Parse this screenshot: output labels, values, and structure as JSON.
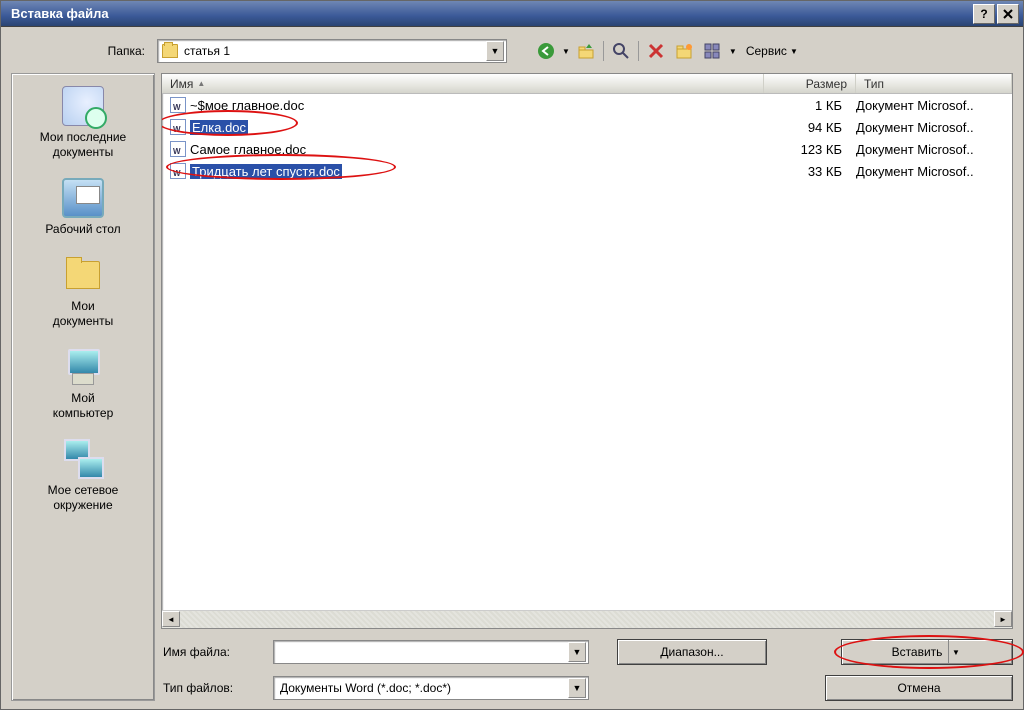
{
  "titlebar": {
    "title": "Вставка файла"
  },
  "toolbar": {
    "folder_label": "Папка:",
    "current_folder": "статья 1",
    "tools_label": "Сервис"
  },
  "columns": {
    "name": "Имя",
    "size": "Размер",
    "type": "Тип"
  },
  "files": [
    {
      "name": "~$мое главное.doc",
      "size": "1 КБ",
      "type": "Документ Microsof..",
      "selected": false
    },
    {
      "name": "Елка.doc",
      "size": "94 КБ",
      "type": "Документ Microsof..",
      "selected": true
    },
    {
      "name": "Самое главное.doc",
      "size": "123 КБ",
      "type": "Документ Microsof..",
      "selected": false
    },
    {
      "name": "Тридцать лет спустя.doc",
      "size": "33 КБ",
      "type": "Документ Microsof..",
      "selected": true
    }
  ],
  "places": [
    {
      "key": "recent",
      "label": "Мои последние документы"
    },
    {
      "key": "desktop",
      "label": "Рабочий стол"
    },
    {
      "key": "mydocs",
      "label": "Мои\nдокументы"
    },
    {
      "key": "mycomp",
      "label": "Мой\nкомпьютер"
    },
    {
      "key": "network",
      "label": "Мое сетевое окружение"
    }
  ],
  "bottom": {
    "filename_label": "Имя файла:",
    "filename_value": "",
    "filetype_label": "Тип файлов:",
    "filetype_value": "Документы Word (*.doc; *.doc*)",
    "range_btn": "Диапазон...",
    "insert_btn": "Вставить",
    "cancel_btn": "Отмена"
  }
}
